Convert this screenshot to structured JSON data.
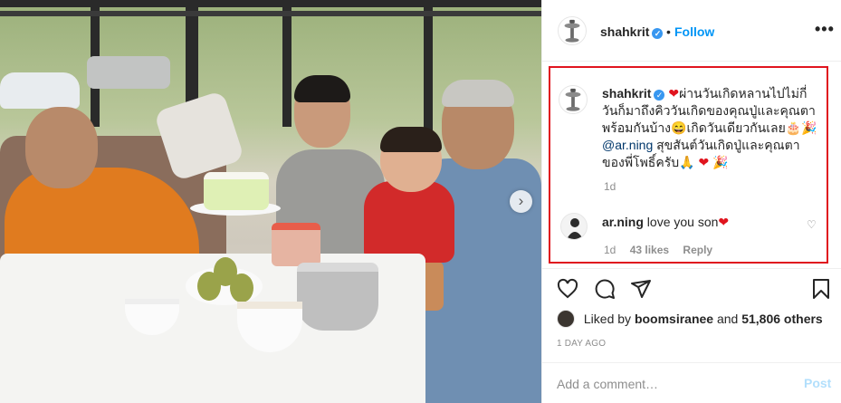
{
  "post": {
    "username": "shahkrit",
    "separator": "•",
    "follow_label": "Follow",
    "more_label": "•••"
  },
  "caption": {
    "username": "shahkrit",
    "text_1": "ผ่านวันเกิดหลานไปไม่กี่วันก็มาถึงคิววันเกิดของคุณปู่และคุณตาพร้อมกันบ้าง",
    "text_2": "เกิดวันเดียวกันเลย",
    "mention": "@ar.ning",
    "text_3": "สุขสันต์วันเกิดปู่และคุณตาของพี่โพธิ์ครับ",
    "age": "1d"
  },
  "comment": {
    "username": "ar.ning",
    "text": "love you son",
    "age": "1d",
    "likes": "43 likes",
    "reply_label": "Reply"
  },
  "likes": {
    "prefix": "Liked by",
    "user": "boomsiranee",
    "middle": "and",
    "others": "51,806 others"
  },
  "timestamp": "1 DAY AGO",
  "add_comment": {
    "placeholder": "Add a comment…",
    "post_label": "Post"
  },
  "icons": {
    "heart": "heart-icon",
    "comment": "comment-icon",
    "share": "share-icon",
    "save": "bookmark-icon",
    "next": "chevron-right-icon"
  },
  "colors": {
    "accent_blue": "#0095f6",
    "highlight_box": "#e0141e",
    "verified": "#3897f0"
  }
}
